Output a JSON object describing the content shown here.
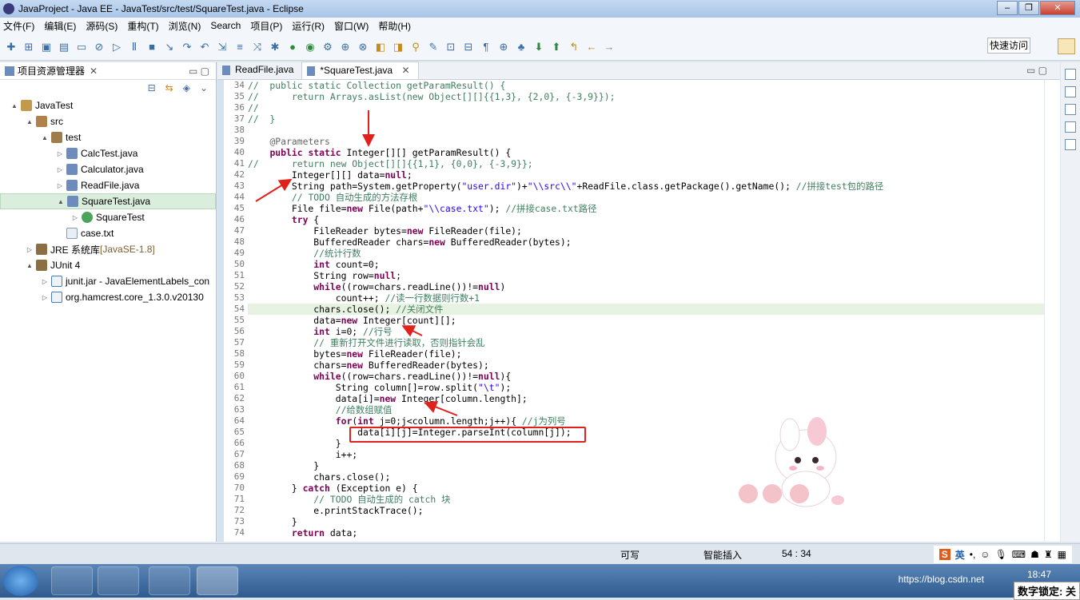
{
  "window": {
    "title": "JavaProject - Java EE - JavaTest/src/test/SquareTest.java - Eclipse"
  },
  "menu": [
    "文件(F)",
    "编辑(E)",
    "源码(S)",
    "重构(T)",
    "浏览(N)",
    "Search",
    "项目(P)",
    "运行(R)",
    "窗口(W)",
    "帮助(H)"
  ],
  "toolbar": {
    "quick_access": "快速访问"
  },
  "explorer": {
    "title": "项目资源管理器",
    "tree": [
      {
        "label": "JavaTest",
        "indent": 0,
        "arrow": "▲",
        "icon": "proj"
      },
      {
        "label": "src",
        "indent": 1,
        "arrow": "▲",
        "icon": "pkgf"
      },
      {
        "label": "test",
        "indent": 2,
        "arrow": "▲",
        "icon": "pkg"
      },
      {
        "label": "CalcTest.java",
        "indent": 3,
        "arrow": "▷",
        "icon": "java"
      },
      {
        "label": "Calculator.java",
        "indent": 3,
        "arrow": "▷",
        "icon": "java"
      },
      {
        "label": "ReadFile.java",
        "indent": 3,
        "arrow": "▷",
        "icon": "java"
      },
      {
        "label": "SquareTest.java",
        "indent": 3,
        "arrow": "▲",
        "icon": "java",
        "selected": true
      },
      {
        "label": "SquareTest",
        "indent": 4,
        "arrow": "▷",
        "icon": "cls"
      },
      {
        "label": "case.txt",
        "indent": 3,
        "arrow": "",
        "icon": "txt"
      },
      {
        "label": "JRE 系统库 ",
        "suffix": "[JavaSE-1.8]",
        "indent": 1,
        "arrow": "▷",
        "icon": "lib"
      },
      {
        "label": "JUnit 4",
        "indent": 1,
        "arrow": "▲",
        "icon": "lib"
      },
      {
        "label": "junit.jar - JavaElementLabels_con",
        "indent": 2,
        "arrow": "▷",
        "icon": "jar"
      },
      {
        "label": "org.hamcrest.core_1.3.0.v20130",
        "indent": 2,
        "arrow": "▷",
        "icon": "jar"
      }
    ]
  },
  "editor": {
    "tabs": [
      {
        "label": "ReadFile.java",
        "active": false
      },
      {
        "label": "*SquareTest.java",
        "active": true
      }
    ],
    "lines": [
      {
        "n": "34",
        "code": "//  public static Collection getParamResult() {"
      },
      {
        "n": "35",
        "code": "//      return Arrays.asList(new Object[][]{{1,3}, {2,0}, {-3,9}});"
      },
      {
        "n": "36",
        "code": "//"
      },
      {
        "n": "37",
        "code": "//  }"
      },
      {
        "n": "38",
        "code": ""
      },
      {
        "n": "39",
        "code": "    @Parameters"
      },
      {
        "n": "40",
        "code": "    public static Integer[][] getParamResult() {"
      },
      {
        "n": "41",
        "code": "//      return new Object[][]{{1,1}, {0,0}, {-3,9}};"
      },
      {
        "n": "42",
        "code": "        Integer[][] data=null;"
      },
      {
        "n": "43",
        "code": "        String path=System.getProperty(\"user.dir\")+\"\\\\src\\\\\"+ReadFile.class.getPackage().getName(); //拼接test包的路径"
      },
      {
        "n": "44",
        "code": "        // TODO 自动生成的方法存根"
      },
      {
        "n": "45",
        "code": "        File file=new File(path+\"\\\\case.txt\"); //拼接case.txt路径"
      },
      {
        "n": "46",
        "code": "        try {"
      },
      {
        "n": "47",
        "code": "            FileReader bytes=new FileReader(file);"
      },
      {
        "n": "48",
        "code": "            BufferedReader chars=new BufferedReader(bytes);"
      },
      {
        "n": "49",
        "code": "            //统计行数"
      },
      {
        "n": "50",
        "code": "            int count=0;"
      },
      {
        "n": "51",
        "code": "            String row=null;"
      },
      {
        "n": "52",
        "code": "            while((row=chars.readLine())!=null)"
      },
      {
        "n": "53",
        "code": "                count++; //读一行数据则行数+1"
      },
      {
        "n": "54",
        "code": "            chars.close(); //关闭文件",
        "hl": true
      },
      {
        "n": "55",
        "code": "            data=new Integer[count][];"
      },
      {
        "n": "56",
        "code": "            int i=0; //行号"
      },
      {
        "n": "57",
        "code": "            // 重新打开文件进行读取，否则指针会乱"
      },
      {
        "n": "58",
        "code": "            bytes=new FileReader(file);"
      },
      {
        "n": "59",
        "code": "            chars=new BufferedReader(bytes);"
      },
      {
        "n": "60",
        "code": "            while((row=chars.readLine())!=null){"
      },
      {
        "n": "61",
        "code": "                String column[]=row.split(\"\\t\");"
      },
      {
        "n": "62",
        "code": "                data[i]=new Integer[column.length];"
      },
      {
        "n": "63",
        "code": "                //给数组赋值"
      },
      {
        "n": "64",
        "code": "                for(int j=0;j<column.length;j++){ //j为列号"
      },
      {
        "n": "65",
        "code": "                    data[i][j]=Integer.parseInt(column[j]);"
      },
      {
        "n": "66",
        "code": "                }"
      },
      {
        "n": "67",
        "code": "                i++;"
      },
      {
        "n": "68",
        "code": "            }"
      },
      {
        "n": "69",
        "code": "            chars.close();"
      },
      {
        "n": "70",
        "code": "        } catch (Exception e) {"
      },
      {
        "n": "71",
        "code": "            // TODO 自动生成的 catch 块"
      },
      {
        "n": "72",
        "code": "            e.printStackTrace();"
      },
      {
        "n": "73",
        "code": "        }"
      },
      {
        "n": "74",
        "code": "        return data;"
      }
    ]
  },
  "status": {
    "writable": "可写",
    "insert_mode": "智能插入",
    "position": "54 : 34"
  },
  "ime": {
    "lang": "英"
  },
  "taskbar": {
    "clock": "18:47",
    "tray_text": "https://blog.csdn.net",
    "numlock": "数字锁定: 关"
  },
  "colors": {
    "annotation_red": "#e0211c",
    "keyword": "#7f0055",
    "comment": "#3f7f5f",
    "string": "#2a00ff"
  }
}
